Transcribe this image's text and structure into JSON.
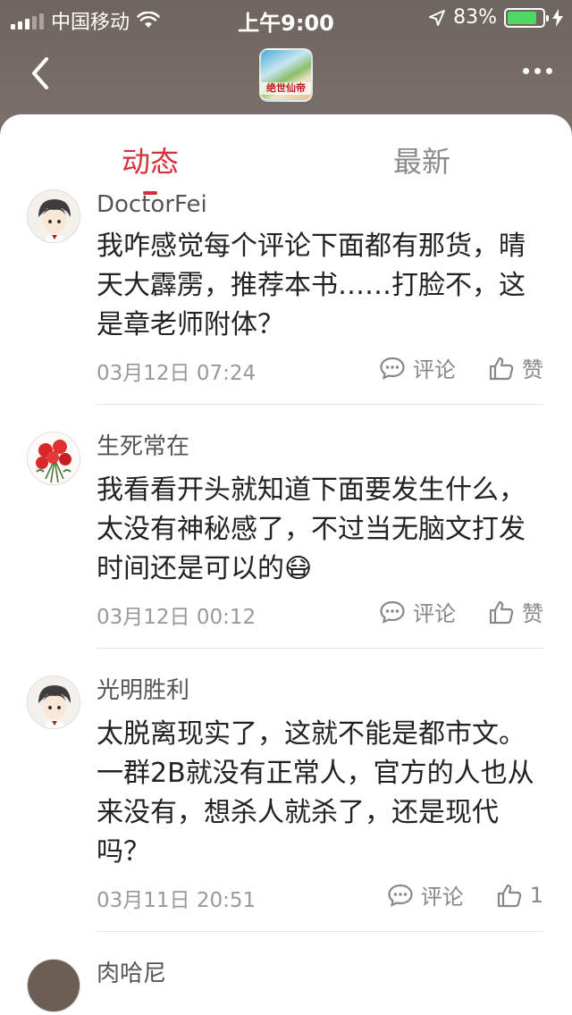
{
  "status_bar": {
    "carrier": "中国移动",
    "time": "上午9:00",
    "battery_percent": "83%",
    "battery_level": 0.83
  },
  "nav": {
    "book_title": "绝世仙帝"
  },
  "tabs": {
    "active": "动态",
    "inactive": "最新"
  },
  "comments": [
    {
      "username": "DoctorFei",
      "content": "我咋感觉每个评论下面都有那货，晴天大霹雳，推荐本书……打脸不，这是章老师附体？",
      "date": "03月12日 07:24",
      "comment_label": "评论",
      "like_label": "赞"
    },
    {
      "username": "生死常在",
      "content": "我看看开头就知道下面要发生什么，太没有神秘感了，不过当无脑文打发时间还是可以的😷",
      "date": "03月12日 00:12",
      "comment_label": "评论",
      "like_label": "赞"
    },
    {
      "username": "光明胜利",
      "content": "太脱离现实了，这就不能是都市文。一群2B就没有正常人，官方的人也从来没有，想杀人就杀了，还是现代吗？",
      "date": "03月11日 20:51",
      "comment_label": "评论",
      "like_label": "1"
    },
    {
      "username": "肉哈尼"
    }
  ],
  "colors": {
    "accent": "#d6313a",
    "battery": "#4cd964"
  }
}
